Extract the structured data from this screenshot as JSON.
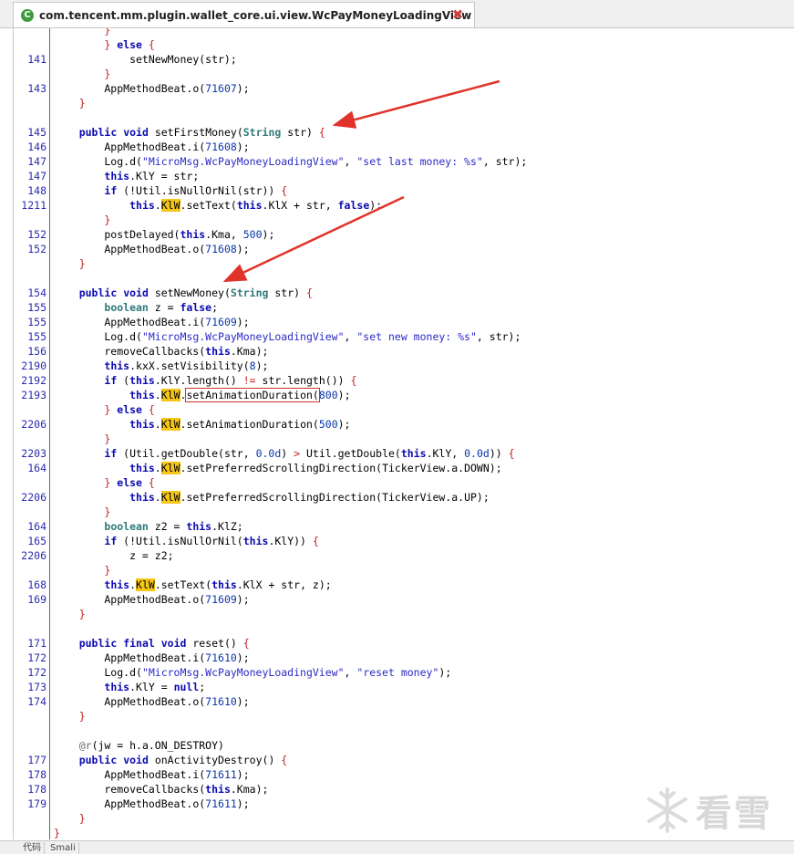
{
  "tab": {
    "title": "com.tencent.mm.plugin.wallet_core.ui.view.WcPayMoneyLoadingView",
    "icon": "class-icon",
    "close": "close-icon"
  },
  "watermark": {
    "logo": "snowflake-logo",
    "text": "看雪"
  },
  "bottom_tabs": [
    "代码",
    "Smali"
  ],
  "colors": {
    "keyword": "#0a0ab0",
    "string": "#2a2ac8",
    "highlight": "#f5c518",
    "arrow": "#e0332b",
    "line_number": "#2b2bb0"
  },
  "code_lines": [
    {
      "ln": "",
      "tokens": [
        {
          "t": "        "
        },
        {
          "t": "}",
          "c": "pn"
        }
      ]
    },
    {
      "ln": "",
      "tokens": [
        {
          "t": "        "
        },
        {
          "t": "}",
          "c": "pn"
        },
        {
          "t": " "
        },
        {
          "t": "else",
          "c": "kw"
        },
        {
          "t": " "
        },
        {
          "t": "{",
          "c": "pn"
        }
      ]
    },
    {
      "ln": "141",
      "tokens": [
        {
          "t": "            setNewMoney(str);"
        }
      ]
    },
    {
      "ln": "",
      "tokens": [
        {
          "t": "        "
        },
        {
          "t": "}",
          "c": "pn"
        }
      ]
    },
    {
      "ln": "143",
      "tokens": [
        {
          "t": "        AppMethodBeat.o("
        },
        {
          "t": "71607",
          "c": "nm"
        },
        {
          "t": ");"
        }
      ]
    },
    {
      "ln": "",
      "tokens": [
        {
          "t": "    "
        },
        {
          "t": "}",
          "c": "pn"
        }
      ]
    },
    {
      "ln": "",
      "tokens": []
    },
    {
      "ln": "145",
      "tokens": [
        {
          "t": "    "
        },
        {
          "t": "public",
          "c": "kw"
        },
        {
          "t": " "
        },
        {
          "t": "void",
          "c": "kw"
        },
        {
          "t": " setFirstMoney("
        },
        {
          "t": "String",
          "c": "ty"
        },
        {
          "t": " str) "
        },
        {
          "t": "{",
          "c": "pn"
        }
      ]
    },
    {
      "ln": "146",
      "tokens": [
        {
          "t": "        AppMethodBeat.i("
        },
        {
          "t": "71608",
          "c": "nm"
        },
        {
          "t": ");"
        }
      ]
    },
    {
      "ln": "147",
      "tokens": [
        {
          "t": "        Log.d("
        },
        {
          "t": "\"MicroMsg.WcPayMoneyLoadingView\"",
          "c": "st"
        },
        {
          "t": ", "
        },
        {
          "t": "\"set last money: %s\"",
          "c": "st"
        },
        {
          "t": ", str);"
        }
      ]
    },
    {
      "ln": "147",
      "tokens": [
        {
          "t": "        "
        },
        {
          "t": "this",
          "c": "kw"
        },
        {
          "t": ".KlY = str;"
        }
      ]
    },
    {
      "ln": "148",
      "tokens": [
        {
          "t": "        "
        },
        {
          "t": "if",
          "c": "kw"
        },
        {
          "t": " (!Util.isNullOrNil(str)) "
        },
        {
          "t": "{",
          "c": "pn"
        }
      ]
    },
    {
      "ln": "1211",
      "tokens": [
        {
          "t": "            "
        },
        {
          "t": "this",
          "c": "kw"
        },
        {
          "t": "."
        },
        {
          "t": "KlW",
          "c": "hl"
        },
        {
          "t": ".setText("
        },
        {
          "t": "this",
          "c": "kw"
        },
        {
          "t": ".KlX + str, "
        },
        {
          "t": "false",
          "c": "kw"
        },
        {
          "t": ");"
        }
      ]
    },
    {
      "ln": "",
      "tokens": [
        {
          "t": "        "
        },
        {
          "t": "}",
          "c": "pn"
        }
      ]
    },
    {
      "ln": "152",
      "tokens": [
        {
          "t": "        postDelayed("
        },
        {
          "t": "this",
          "c": "kw"
        },
        {
          "t": ".Kma, "
        },
        {
          "t": "500",
          "c": "nm"
        },
        {
          "t": ");"
        }
      ]
    },
    {
      "ln": "152",
      "tokens": [
        {
          "t": "        AppMethodBeat.o("
        },
        {
          "t": "71608",
          "c": "nm"
        },
        {
          "t": ");"
        }
      ]
    },
    {
      "ln": "",
      "tokens": [
        {
          "t": "    "
        },
        {
          "t": "}",
          "c": "pn"
        }
      ]
    },
    {
      "ln": "",
      "tokens": []
    },
    {
      "ln": "154",
      "tokens": [
        {
          "t": "    "
        },
        {
          "t": "public",
          "c": "kw"
        },
        {
          "t": " "
        },
        {
          "t": "void",
          "c": "kw"
        },
        {
          "t": " setNewMoney("
        },
        {
          "t": "String",
          "c": "ty"
        },
        {
          "t": " str) "
        },
        {
          "t": "{",
          "c": "pn"
        }
      ]
    },
    {
      "ln": "155",
      "tokens": [
        {
          "t": "        "
        },
        {
          "t": "boolean",
          "c": "ty"
        },
        {
          "t": " z = "
        },
        {
          "t": "false",
          "c": "kw"
        },
        {
          "t": ";"
        }
      ]
    },
    {
      "ln": "155",
      "tokens": [
        {
          "t": "        AppMethodBeat.i("
        },
        {
          "t": "71609",
          "c": "nm"
        },
        {
          "t": ");"
        }
      ]
    },
    {
      "ln": "155",
      "tokens": [
        {
          "t": "        Log.d("
        },
        {
          "t": "\"MicroMsg.WcPayMoneyLoadingView\"",
          "c": "st"
        },
        {
          "t": ", "
        },
        {
          "t": "\"set new money: %s\"",
          "c": "st"
        },
        {
          "t": ", str);"
        }
      ]
    },
    {
      "ln": "156",
      "tokens": [
        {
          "t": "        removeCallbacks("
        },
        {
          "t": "this",
          "c": "kw"
        },
        {
          "t": ".Kma);"
        }
      ]
    },
    {
      "ln": "2190",
      "tokens": [
        {
          "t": "        "
        },
        {
          "t": "this",
          "c": "kw"
        },
        {
          "t": ".kxX.setVisibility("
        },
        {
          "t": "8",
          "c": "nm"
        },
        {
          "t": ");"
        }
      ]
    },
    {
      "ln": "2192",
      "tokens": [
        {
          "t": "        "
        },
        {
          "t": "if",
          "c": "kw"
        },
        {
          "t": " ("
        },
        {
          "t": "this",
          "c": "kw"
        },
        {
          "t": ".KlY.length() "
        },
        {
          "t": "!=",
          "c": "pn"
        },
        {
          "t": " str.length()) "
        },
        {
          "t": "{",
          "c": "pn"
        }
      ]
    },
    {
      "ln": "2193",
      "tokens": [
        {
          "t": "            "
        },
        {
          "t": "this",
          "c": "kw"
        },
        {
          "t": "."
        },
        {
          "t": "KlW",
          "c": "hl"
        },
        {
          "t": "."
        },
        {
          "t": "setAnimationDuration(",
          "c": "box"
        },
        {
          "t": "800",
          "c": "nm"
        },
        {
          "t": ");"
        }
      ]
    },
    {
      "ln": "",
      "tokens": [
        {
          "t": "        "
        },
        {
          "t": "}",
          "c": "pn"
        },
        {
          "t": " "
        },
        {
          "t": "else",
          "c": "kw"
        },
        {
          "t": " "
        },
        {
          "t": "{",
          "c": "pn"
        }
      ]
    },
    {
      "ln": "2206",
      "tokens": [
        {
          "t": "            "
        },
        {
          "t": "this",
          "c": "kw"
        },
        {
          "t": "."
        },
        {
          "t": "KlW",
          "c": "hl"
        },
        {
          "t": ".setAnimationDuration("
        },
        {
          "t": "500",
          "c": "nm"
        },
        {
          "t": ");"
        }
      ]
    },
    {
      "ln": "",
      "tokens": [
        {
          "t": "        "
        },
        {
          "t": "}",
          "c": "pn"
        }
      ]
    },
    {
      "ln": "2203",
      "tokens": [
        {
          "t": "        "
        },
        {
          "t": "if",
          "c": "kw"
        },
        {
          "t": " (Util.getDouble(str, "
        },
        {
          "t": "0.0d",
          "c": "nm"
        },
        {
          "t": ") "
        },
        {
          "t": ">",
          "c": "pn"
        },
        {
          "t": " Util.getDouble("
        },
        {
          "t": "this",
          "c": "kw"
        },
        {
          "t": ".KlY, "
        },
        {
          "t": "0.0d",
          "c": "nm"
        },
        {
          "t": ")) "
        },
        {
          "t": "{",
          "c": "pn"
        }
      ]
    },
    {
      "ln": "164",
      "tokens": [
        {
          "t": "            "
        },
        {
          "t": "this",
          "c": "kw"
        },
        {
          "t": "."
        },
        {
          "t": "KlW",
          "c": "hl"
        },
        {
          "t": ".setPreferredScrollingDirection(TickerView.a.DOWN);"
        }
      ]
    },
    {
      "ln": "",
      "tokens": [
        {
          "t": "        "
        },
        {
          "t": "}",
          "c": "pn"
        },
        {
          "t": " "
        },
        {
          "t": "else",
          "c": "kw"
        },
        {
          "t": " "
        },
        {
          "t": "{",
          "c": "pn"
        }
      ]
    },
    {
      "ln": "2206",
      "tokens": [
        {
          "t": "            "
        },
        {
          "t": "this",
          "c": "kw"
        },
        {
          "t": "."
        },
        {
          "t": "KlW",
          "c": "hl"
        },
        {
          "t": ".setPreferredScrollingDirection(TickerView.a.UP);"
        }
      ]
    },
    {
      "ln": "",
      "tokens": [
        {
          "t": "        "
        },
        {
          "t": "}",
          "c": "pn"
        }
      ]
    },
    {
      "ln": "164",
      "tokens": [
        {
          "t": "        "
        },
        {
          "t": "boolean",
          "c": "ty"
        },
        {
          "t": " z2 = "
        },
        {
          "t": "this",
          "c": "kw"
        },
        {
          "t": ".KlZ;"
        }
      ]
    },
    {
      "ln": "165",
      "tokens": [
        {
          "t": "        "
        },
        {
          "t": "if",
          "c": "kw"
        },
        {
          "t": " (!Util.isNullOrNil("
        },
        {
          "t": "this",
          "c": "kw"
        },
        {
          "t": ".KlY)) "
        },
        {
          "t": "{",
          "c": "pn"
        }
      ]
    },
    {
      "ln": "2206",
      "tokens": [
        {
          "t": "            z = z2;"
        }
      ]
    },
    {
      "ln": "",
      "tokens": [
        {
          "t": "        "
        },
        {
          "t": "}",
          "c": "pn"
        }
      ]
    },
    {
      "ln": "168",
      "tokens": [
        {
          "t": "        "
        },
        {
          "t": "this",
          "c": "kw"
        },
        {
          "t": "."
        },
        {
          "t": "KlW",
          "c": "hl"
        },
        {
          "t": ".setText("
        },
        {
          "t": "this",
          "c": "kw"
        },
        {
          "t": ".KlX + str, z);"
        }
      ]
    },
    {
      "ln": "169",
      "tokens": [
        {
          "t": "        AppMethodBeat.o("
        },
        {
          "t": "71609",
          "c": "nm"
        },
        {
          "t": ");"
        }
      ]
    },
    {
      "ln": "",
      "tokens": [
        {
          "t": "    "
        },
        {
          "t": "}",
          "c": "pn"
        }
      ]
    },
    {
      "ln": "",
      "tokens": []
    },
    {
      "ln": "171",
      "tokens": [
        {
          "t": "    "
        },
        {
          "t": "public",
          "c": "kw"
        },
        {
          "t": " "
        },
        {
          "t": "final",
          "c": "kw"
        },
        {
          "t": " "
        },
        {
          "t": "void",
          "c": "kw"
        },
        {
          "t": " reset() "
        },
        {
          "t": "{",
          "c": "pn"
        }
      ]
    },
    {
      "ln": "172",
      "tokens": [
        {
          "t": "        AppMethodBeat.i("
        },
        {
          "t": "71610",
          "c": "nm"
        },
        {
          "t": ");"
        }
      ]
    },
    {
      "ln": "172",
      "tokens": [
        {
          "t": "        Log.d("
        },
        {
          "t": "\"MicroMsg.WcPayMoneyLoadingView\"",
          "c": "st"
        },
        {
          "t": ", "
        },
        {
          "t": "\"reset money\"",
          "c": "st"
        },
        {
          "t": ");"
        }
      ]
    },
    {
      "ln": "173",
      "tokens": [
        {
          "t": "        "
        },
        {
          "t": "this",
          "c": "kw"
        },
        {
          "t": ".KlY = "
        },
        {
          "t": "null",
          "c": "kw"
        },
        {
          "t": ";"
        }
      ]
    },
    {
      "ln": "174",
      "tokens": [
        {
          "t": "        AppMethodBeat.o("
        },
        {
          "t": "71610",
          "c": "nm"
        },
        {
          "t": ");"
        }
      ]
    },
    {
      "ln": "",
      "tokens": [
        {
          "t": "    "
        },
        {
          "t": "}",
          "c": "pn"
        }
      ]
    },
    {
      "ln": "",
      "tokens": []
    },
    {
      "ln": "",
      "tokens": [
        {
          "t": "    "
        },
        {
          "t": "@r",
          "c": "ann"
        },
        {
          "t": "(jw = h.a.ON_DESTROY)"
        }
      ]
    },
    {
      "ln": "177",
      "tokens": [
        {
          "t": "    "
        },
        {
          "t": "public",
          "c": "kw"
        },
        {
          "t": " "
        },
        {
          "t": "void",
          "c": "kw"
        },
        {
          "t": " onActivityDestroy() "
        },
        {
          "t": "{",
          "c": "pn"
        }
      ]
    },
    {
      "ln": "178",
      "tokens": [
        {
          "t": "        AppMethodBeat.i("
        },
        {
          "t": "71611",
          "c": "nm"
        },
        {
          "t": ");"
        }
      ]
    },
    {
      "ln": "178",
      "tokens": [
        {
          "t": "        removeCallbacks("
        },
        {
          "t": "this",
          "c": "kw"
        },
        {
          "t": ".Kma);"
        }
      ]
    },
    {
      "ln": "179",
      "tokens": [
        {
          "t": "        AppMethodBeat.o("
        },
        {
          "t": "71611",
          "c": "nm"
        },
        {
          "t": ");"
        }
      ]
    },
    {
      "ln": "",
      "tokens": [
        {
          "t": "    "
        },
        {
          "t": "}",
          "c": "pn"
        }
      ]
    },
    {
      "ln": "",
      "tokens": [
        {
          "t": "}",
          "c": "pn"
        }
      ]
    }
  ]
}
